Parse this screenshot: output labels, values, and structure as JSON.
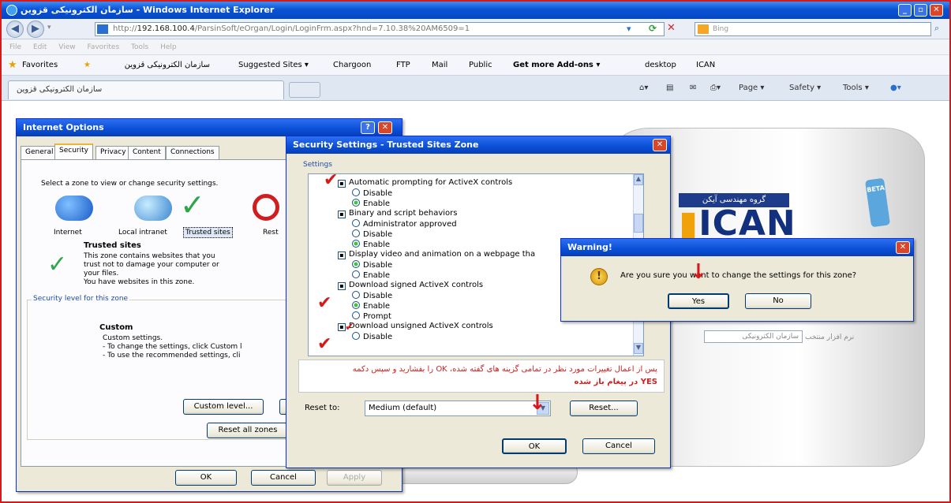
{
  "browser": {
    "title": "سازمان الکترونیکی قزوین - Windows Internet Explorer",
    "url_prefix": "http://",
    "url_host": "192.168.100.4",
    "url_rest": "/ParsinSoft/eOrgan/Login/LoginFrm.aspx?hnd=7.10.38%20AM6509=1",
    "menu": [
      "File",
      "Edit",
      "View",
      "Favorites",
      "Tools",
      "Help"
    ],
    "favorites_label": "Favorites",
    "favorites": [
      "سازمان الکترونیکی قزوین",
      "Suggested Sites ▾",
      "Chargoon",
      "FTP",
      "Mail",
      "Public",
      "Get more Add-ons ▾",
      "desktop",
      "ICAN"
    ],
    "tab_label": "سازمان الکترونیکی قزوین",
    "commands": [
      "Page ▾",
      "Safety ▾",
      "Tools ▾"
    ]
  },
  "internet_options": {
    "title": "Internet Options",
    "title_buttons": [
      "?",
      "✕"
    ],
    "tabs": [
      "General",
      "Security",
      "Privacy",
      "Content",
      "Connections"
    ],
    "select_zone_text": "Select a zone to view or change security settings.",
    "zones": [
      "Internet",
      "Local intranet",
      "Trusted sites",
      "Rest"
    ],
    "zone_heading": "Trusted sites",
    "zone_desc": [
      "This zone contains websites that you",
      "trust not to damage your computer or",
      "your files.",
      "You have websites in this zone."
    ],
    "security_level_label": "Security level for this zone",
    "custom_heading": "Custom",
    "custom_lines": [
      "Custom settings.",
      "- To change the settings, click Custom l",
      "- To use the recommended settings, cli"
    ],
    "custom_level_button": "Custom level...",
    "reset_all_button": "Reset all zones",
    "ok": "OK",
    "cancel": "Cancel",
    "apply": "Apply"
  },
  "security_settings": {
    "title": "Security Settings - Trusted Sites Zone",
    "settings_label": "Settings",
    "items": [
      {
        "type": "header",
        "text": "Automatic prompting for ActiveX controls"
      },
      {
        "type": "radio",
        "text": "Disable",
        "on": false
      },
      {
        "type": "radio",
        "text": "Enable",
        "on": true
      },
      {
        "type": "header",
        "text": "Binary and script behaviors"
      },
      {
        "type": "radio",
        "text": "Administrator approved",
        "on": false
      },
      {
        "type": "radio",
        "text": "Disable",
        "on": false
      },
      {
        "type": "radio",
        "text": "Enable",
        "on": true
      },
      {
        "type": "header",
        "text": "Display video and animation on a webpage tha"
      },
      {
        "type": "radio",
        "text": "Disable",
        "on": true
      },
      {
        "type": "radio",
        "text": "Enable",
        "on": false
      },
      {
        "type": "header",
        "text": "Download signed ActiveX controls"
      },
      {
        "type": "radio",
        "text": "Disable",
        "on": false
      },
      {
        "type": "radio",
        "text": "Enable",
        "on": true
      },
      {
        "type": "radio",
        "text": "Prompt",
        "on": false
      },
      {
        "type": "header",
        "text": "Download unsigned ActiveX controls"
      },
      {
        "type": "radio",
        "text": "Disable",
        "on": false
      }
    ],
    "note_line1": "پس از اعمال تغییرات مورد نظر در تمامی گزینه های گفته شده، OK را بفشارید و سپس دکمه",
    "note_line2": "YES در پیغام باز شده",
    "reset_to_label": "Reset to:",
    "reset_value": "Medium (default)",
    "reset_button": "Reset...",
    "ok": "OK",
    "cancel": "Cancel"
  },
  "warning": {
    "title": "Warning!",
    "message": "Are you sure you want to change the settings for this zone?",
    "yes": "Yes",
    "no": "No"
  },
  "page": {
    "tag": "BETA",
    "logo_header": "گروه مهندسی آیکن",
    "logo_main": "ICAN",
    "login_label": "نرم افزار منتخب",
    "login_value": "سازمان الکترونیکی"
  }
}
